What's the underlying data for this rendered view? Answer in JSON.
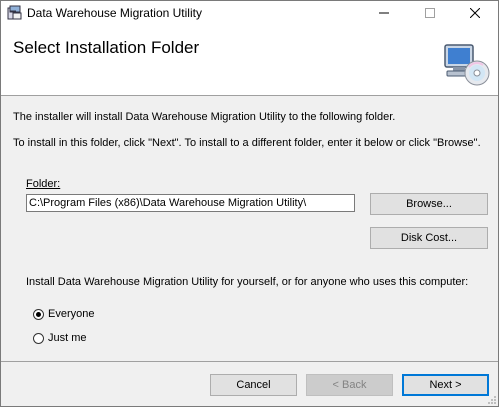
{
  "window": {
    "title": "Data Warehouse Migration Utility",
    "minimize_glyph": "—",
    "maximize_glyph": "☐",
    "close_glyph": "✕"
  },
  "header": {
    "title": "Select Installation Folder",
    "icon": "computer-cd-icon"
  },
  "body": {
    "line1": "The installer will install Data Warehouse Migration Utility to the following folder.",
    "line2": "To install in this folder, click \"Next\". To install to a different folder, enter it below or click \"Browse\"."
  },
  "folder": {
    "label": "Folder:",
    "value": "C:\\Program Files (x86)\\Data Warehouse Migration Utility\\"
  },
  "buttons": {
    "browse": "Browse...",
    "disk_cost": "Disk Cost...",
    "cancel": "Cancel",
    "back": "< Back",
    "next": "Next >"
  },
  "install_for": {
    "prompt": "Install Data Warehouse Migration Utility for yourself, or for anyone who uses this computer:",
    "options": [
      {
        "label": "Everyone",
        "selected": true
      },
      {
        "label": "Just me",
        "selected": false
      }
    ]
  },
  "colors": {
    "accent": "#0078d7",
    "background": "#f0f0f0"
  }
}
